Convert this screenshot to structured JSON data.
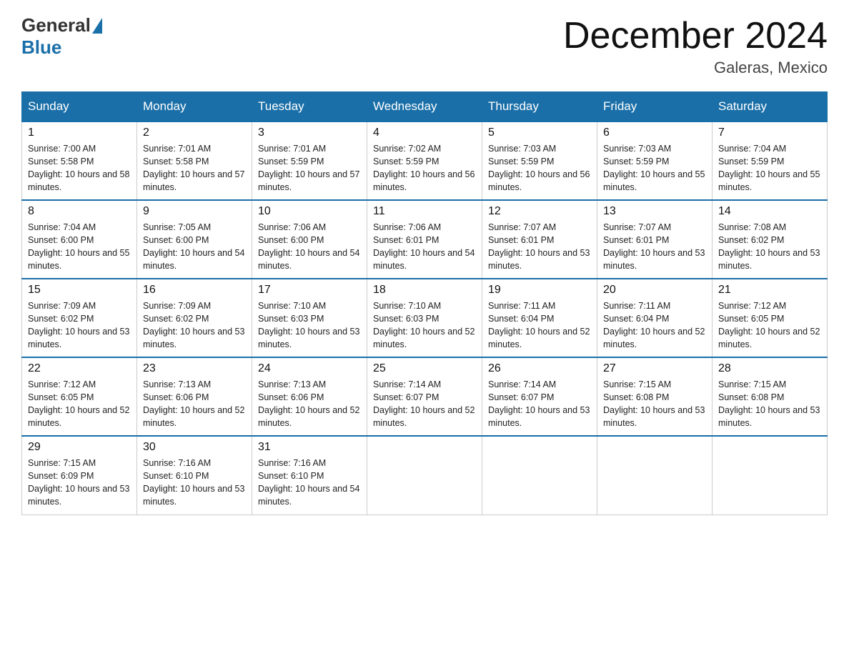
{
  "header": {
    "logo_general": "General",
    "logo_blue": "Blue",
    "title": "December 2024",
    "location": "Galeras, Mexico"
  },
  "days_of_week": [
    "Sunday",
    "Monday",
    "Tuesday",
    "Wednesday",
    "Thursday",
    "Friday",
    "Saturday"
  ],
  "weeks": [
    [
      {
        "day": "1",
        "sunrise": "7:00 AM",
        "sunset": "5:58 PM",
        "daylight": "10 hours and 58 minutes."
      },
      {
        "day": "2",
        "sunrise": "7:01 AM",
        "sunset": "5:58 PM",
        "daylight": "10 hours and 57 minutes."
      },
      {
        "day": "3",
        "sunrise": "7:01 AM",
        "sunset": "5:59 PM",
        "daylight": "10 hours and 57 minutes."
      },
      {
        "day": "4",
        "sunrise": "7:02 AM",
        "sunset": "5:59 PM",
        "daylight": "10 hours and 56 minutes."
      },
      {
        "day": "5",
        "sunrise": "7:03 AM",
        "sunset": "5:59 PM",
        "daylight": "10 hours and 56 minutes."
      },
      {
        "day": "6",
        "sunrise": "7:03 AM",
        "sunset": "5:59 PM",
        "daylight": "10 hours and 55 minutes."
      },
      {
        "day": "7",
        "sunrise": "7:04 AM",
        "sunset": "5:59 PM",
        "daylight": "10 hours and 55 minutes."
      }
    ],
    [
      {
        "day": "8",
        "sunrise": "7:04 AM",
        "sunset": "6:00 PM",
        "daylight": "10 hours and 55 minutes."
      },
      {
        "day": "9",
        "sunrise": "7:05 AM",
        "sunset": "6:00 PM",
        "daylight": "10 hours and 54 minutes."
      },
      {
        "day": "10",
        "sunrise": "7:06 AM",
        "sunset": "6:00 PM",
        "daylight": "10 hours and 54 minutes."
      },
      {
        "day": "11",
        "sunrise": "7:06 AM",
        "sunset": "6:01 PM",
        "daylight": "10 hours and 54 minutes."
      },
      {
        "day": "12",
        "sunrise": "7:07 AM",
        "sunset": "6:01 PM",
        "daylight": "10 hours and 53 minutes."
      },
      {
        "day": "13",
        "sunrise": "7:07 AM",
        "sunset": "6:01 PM",
        "daylight": "10 hours and 53 minutes."
      },
      {
        "day": "14",
        "sunrise": "7:08 AM",
        "sunset": "6:02 PM",
        "daylight": "10 hours and 53 minutes."
      }
    ],
    [
      {
        "day": "15",
        "sunrise": "7:09 AM",
        "sunset": "6:02 PM",
        "daylight": "10 hours and 53 minutes."
      },
      {
        "day": "16",
        "sunrise": "7:09 AM",
        "sunset": "6:02 PM",
        "daylight": "10 hours and 53 minutes."
      },
      {
        "day": "17",
        "sunrise": "7:10 AM",
        "sunset": "6:03 PM",
        "daylight": "10 hours and 53 minutes."
      },
      {
        "day": "18",
        "sunrise": "7:10 AM",
        "sunset": "6:03 PM",
        "daylight": "10 hours and 52 minutes."
      },
      {
        "day": "19",
        "sunrise": "7:11 AM",
        "sunset": "6:04 PM",
        "daylight": "10 hours and 52 minutes."
      },
      {
        "day": "20",
        "sunrise": "7:11 AM",
        "sunset": "6:04 PM",
        "daylight": "10 hours and 52 minutes."
      },
      {
        "day": "21",
        "sunrise": "7:12 AM",
        "sunset": "6:05 PM",
        "daylight": "10 hours and 52 minutes."
      }
    ],
    [
      {
        "day": "22",
        "sunrise": "7:12 AM",
        "sunset": "6:05 PM",
        "daylight": "10 hours and 52 minutes."
      },
      {
        "day": "23",
        "sunrise": "7:13 AM",
        "sunset": "6:06 PM",
        "daylight": "10 hours and 52 minutes."
      },
      {
        "day": "24",
        "sunrise": "7:13 AM",
        "sunset": "6:06 PM",
        "daylight": "10 hours and 52 minutes."
      },
      {
        "day": "25",
        "sunrise": "7:14 AM",
        "sunset": "6:07 PM",
        "daylight": "10 hours and 52 minutes."
      },
      {
        "day": "26",
        "sunrise": "7:14 AM",
        "sunset": "6:07 PM",
        "daylight": "10 hours and 53 minutes."
      },
      {
        "day": "27",
        "sunrise": "7:15 AM",
        "sunset": "6:08 PM",
        "daylight": "10 hours and 53 minutes."
      },
      {
        "day": "28",
        "sunrise": "7:15 AM",
        "sunset": "6:08 PM",
        "daylight": "10 hours and 53 minutes."
      }
    ],
    [
      {
        "day": "29",
        "sunrise": "7:15 AM",
        "sunset": "6:09 PM",
        "daylight": "10 hours and 53 minutes."
      },
      {
        "day": "30",
        "sunrise": "7:16 AM",
        "sunset": "6:10 PM",
        "daylight": "10 hours and 53 minutes."
      },
      {
        "day": "31",
        "sunrise": "7:16 AM",
        "sunset": "6:10 PM",
        "daylight": "10 hours and 54 minutes."
      },
      null,
      null,
      null,
      null
    ]
  ],
  "labels": {
    "sunrise_prefix": "Sunrise: ",
    "sunset_prefix": "Sunset: ",
    "daylight_prefix": "Daylight: "
  }
}
